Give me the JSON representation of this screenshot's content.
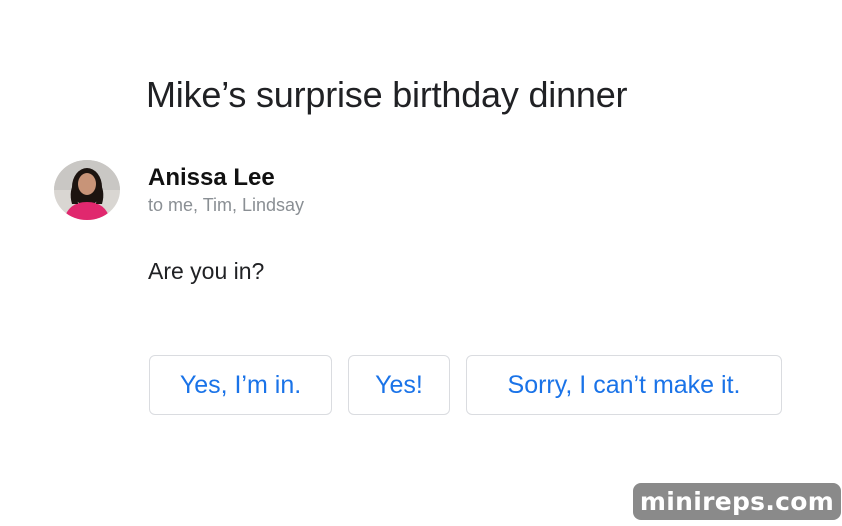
{
  "email": {
    "subject": "Mike’s surprise birthday dinner",
    "sender": {
      "name": "Anissa Lee",
      "recipients": "to me, Tim, Lindsay",
      "avatar": "sender-avatar-photo"
    },
    "body": "Are you in?"
  },
  "smart_replies": [
    {
      "label": "Yes, I’m in."
    },
    {
      "label": "Yes!"
    },
    {
      "label": "Sorry, I can’t make it."
    }
  ],
  "watermark": "minireps.com",
  "colors": {
    "accent": "#1a73e8",
    "button_border": "#dadce0",
    "secondary_text": "#8a8f94",
    "primary_text": "#202124",
    "watermark_bg": "#8a8a8a"
  }
}
